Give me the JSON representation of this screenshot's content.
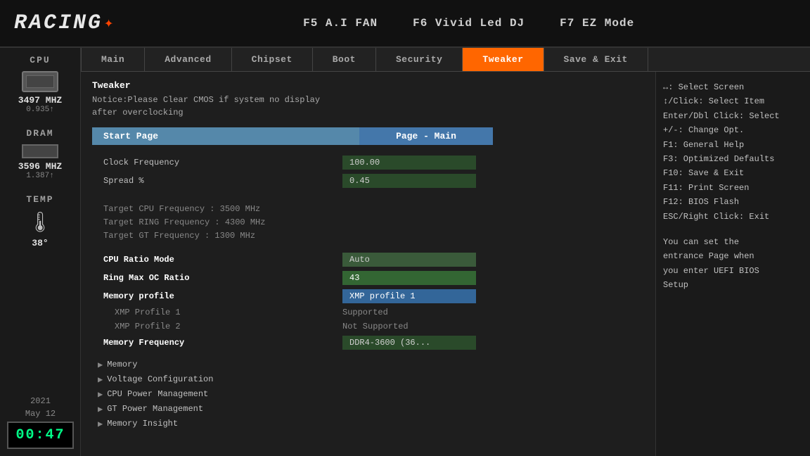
{
  "topbar": {
    "logo": "RACING",
    "logo_accent": "✦",
    "fn_keys": [
      {
        "label": "F5 A.I FAN"
      },
      {
        "label": "F6 Vivid Led DJ"
      },
      {
        "label": "F7 EZ Mode"
      }
    ]
  },
  "sidebar": {
    "cpu_label": "CPU",
    "cpu_mhz": "3497 MHZ",
    "cpu_sub": "0.935↑",
    "dram_label": "DRAM",
    "dram_mhz": "3596 MHZ",
    "dram_sub": "1.387↑",
    "temp_label": "TEMP",
    "temp_value": "38°",
    "date": "2021",
    "date2": "May  12",
    "clock": "00:47"
  },
  "nav": {
    "tabs": [
      {
        "label": "Main",
        "active": false
      },
      {
        "label": "Advanced",
        "active": false
      },
      {
        "label": "Chipset",
        "active": false
      },
      {
        "label": "Boot",
        "active": false
      },
      {
        "label": "Security",
        "active": false
      },
      {
        "label": "Tweaker",
        "active": true
      },
      {
        "label": "Save & Exit",
        "active": false
      }
    ]
  },
  "main_panel": {
    "section_title": "Tweaker",
    "notice_line1": "Notice:Please Clear CMOS if system no display",
    "notice_line2": "after overclocking",
    "start_page_label": "Start Page",
    "start_page_value": "Page - Main",
    "settings": [
      {
        "label": "Clock Frequency",
        "value": "100.00",
        "style": "dark-green"
      },
      {
        "label": "Spread %",
        "value": "0.45",
        "style": "dark-green"
      }
    ],
    "targets": [
      "Target CPU Frequency : 3500 MHz",
      "Target RING Frequency : 4300 MHz",
      "Target GT Frequency : 1300 MHz"
    ],
    "advanced_settings": [
      {
        "label": "CPU Ratio Mode",
        "value": "Auto",
        "style": "auto-val"
      },
      {
        "label": "Ring Max OC Ratio",
        "value": "43",
        "style": "selected-43"
      },
      {
        "label": "Memory profile",
        "value": "XMP profile 1",
        "style": "blue-selected"
      },
      {
        "label": "XMP Profile 1",
        "value": "Supported",
        "style": "plain"
      },
      {
        "label": "XMP Profile 2",
        "value": "Not Supported",
        "style": "plain"
      },
      {
        "label": "Memory Frequency",
        "value": "DDR4-3600  (36...",
        "style": "dark-green"
      }
    ],
    "collapsible": [
      "Memory",
      "Voltage Configuration",
      "CPU Power Management",
      "GT Power Management",
      "Memory Insight"
    ]
  },
  "help": {
    "shortcuts": [
      "↔: Select Screen",
      "↕/Click: Select Item",
      "Enter/Dbl Click: Select",
      "+/-: Change Opt.",
      "F1: General Help",
      "F3: Optimized Defaults",
      "F10: Save & Exit",
      "F11: Print Screen",
      "F12: BIOS Flash",
      "ESC/Right Click: Exit"
    ],
    "description": "You can set the\nentrance Page when\nyou enter UEFI BIOS\nSetup"
  }
}
